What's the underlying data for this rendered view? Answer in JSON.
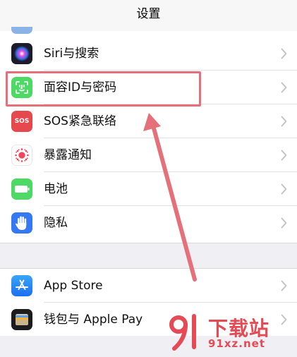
{
  "nav": {
    "title": "设置"
  },
  "group1": [
    {
      "label": "Siri与搜索",
      "icon": "siri-icon",
      "color": "#1c1c2e"
    },
    {
      "label": "面容ID与密码",
      "icon": "face-id-icon",
      "color": "#4cd964"
    },
    {
      "label": "SOS紧急联络",
      "icon": "sos-icon",
      "color": "#e5484d"
    },
    {
      "label": "暴露通知",
      "icon": "exposure-notification-icon",
      "color": "#ffffff"
    },
    {
      "label": "电池",
      "icon": "battery-icon",
      "color": "#4cd964"
    },
    {
      "label": "隐私",
      "icon": "privacy-hand-icon",
      "color": "#3478f6"
    }
  ],
  "group2": [
    {
      "label": "App Store",
      "icon": "app-store-icon",
      "color": "#2f8cf6"
    },
    {
      "label": "钱包与 Apple Pay",
      "icon": "wallet-icon",
      "color": "#1c1c1e"
    }
  ],
  "sos_icon_text": "SOS",
  "watermark": {
    "text": "下载站",
    "url": "91xz.net",
    "color": "#e44b55"
  },
  "annotation_color": "#e5707a"
}
